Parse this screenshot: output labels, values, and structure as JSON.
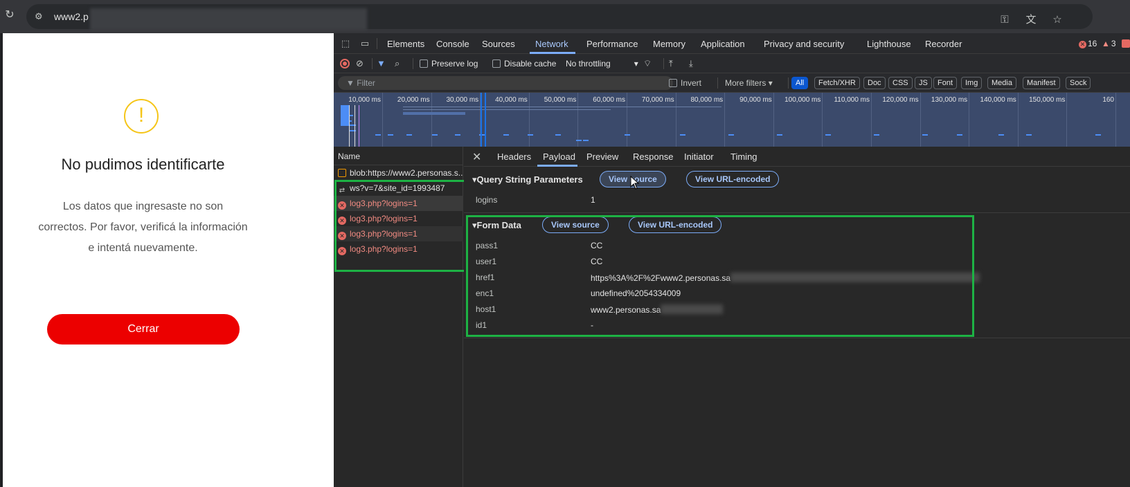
{
  "browser": {
    "url": "www2.p"
  },
  "page": {
    "title": "No pudimos identificarte",
    "message": "Los datos que ingresaste no son correctos. Por favor, verificá la información e intentá nuevamente.",
    "close_button": "Cerrar",
    "warning_glyph": "!"
  },
  "devtools": {
    "tabs": [
      "Elements",
      "Console",
      "Sources",
      "Network",
      "Performance",
      "Memory",
      "Application",
      "Privacy and security",
      "Lighthouse",
      "Recorder"
    ],
    "active_tab": "Network",
    "error_count": "16",
    "warning_count": "3",
    "toolbar": {
      "preserve_log": "Preserve log",
      "disable_cache": "Disable cache",
      "throttling": "No throttling"
    },
    "filter": {
      "placeholder": "Filter",
      "invert": "Invert",
      "more_filters": "More filters",
      "types": [
        "All",
        "Fetch/XHR",
        "Doc",
        "CSS",
        "JS",
        "Font",
        "Img",
        "Media",
        "Manifest",
        "Sock"
      ]
    },
    "timeline_ticks": [
      "10,000 ms",
      "20,000 ms",
      "30,000 ms",
      "40,000 ms",
      "50,000 ms",
      "60,000 ms",
      "70,000 ms",
      "80,000 ms",
      "90,000 ms",
      "100,000 ms",
      "110,000 ms",
      "120,000 ms",
      "130,000 ms",
      "140,000 ms",
      "150,000 ms",
      "160"
    ],
    "requests": {
      "header": "Name",
      "items": [
        {
          "name": "blob:https://www2.personas.s..."
        },
        {
          "name": "ws?v=7&site_id=1993487"
        },
        {
          "name": "log3.php?logins=1"
        },
        {
          "name": "log3.php?logins=1"
        },
        {
          "name": "log3.php?logins=1"
        },
        {
          "name": "log3.php?logins=1"
        }
      ]
    },
    "detail": {
      "close": "✕",
      "tabs": [
        "Headers",
        "Payload",
        "Preview",
        "Response",
        "Initiator",
        "Timing"
      ],
      "active_tab": "Payload",
      "query": {
        "title": "Query String Parameters",
        "view_source": "View source",
        "view_url_encoded": "View URL-encoded",
        "params": [
          {
            "key": "logins",
            "value": "1"
          }
        ]
      },
      "form": {
        "title": "Form Data",
        "view_source": "View source",
        "view_url_encoded": "View URL-encoded",
        "params": [
          {
            "key": "pass1",
            "value": "CC"
          },
          {
            "key": "user1",
            "value": "CC"
          },
          {
            "key": "href1",
            "value": "https%3A%2F%2Fwww2.personas.sa"
          },
          {
            "key": "enc1",
            "value": "undefined%2054334009"
          },
          {
            "key": "host1",
            "value": "www2.personas.sa"
          },
          {
            "key": "id1",
            "value": "-"
          }
        ]
      }
    }
  }
}
